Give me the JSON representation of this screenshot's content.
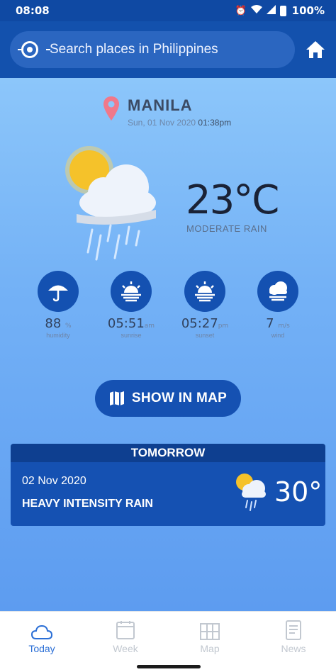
{
  "status_bar": {
    "time": "08:08",
    "battery": "100%"
  },
  "search": {
    "placeholder": "Search places in Philippines"
  },
  "location": {
    "city": "MANILA",
    "date": "Sun, 01 Nov 2020",
    "time": "01:38pm"
  },
  "current": {
    "temperature": "23°C",
    "condition": "MODERATE RAIN",
    "icon": "sun-cloud-rain-icon"
  },
  "stats": [
    {
      "value": "88",
      "unit": "%",
      "label": "humidity",
      "icon": "umbrella-icon"
    },
    {
      "value": "05:51",
      "unit": "am",
      "label": "sunrise",
      "icon": "sunrise-icon"
    },
    {
      "value": "05:27",
      "unit": "pm",
      "label": "sunset",
      "icon": "sunset-icon"
    },
    {
      "value": "7",
      "unit": "m/s",
      "label": "wind",
      "icon": "wind-cloud-icon"
    }
  ],
  "map_button": {
    "label": "SHOW IN MAP"
  },
  "tomorrow": {
    "title": "TOMORROW",
    "date": "02 Nov 2020",
    "condition": "HEAVY INTENSITY RAIN",
    "temperature": "30°"
  },
  "nav": [
    {
      "label": "Today",
      "icon": "cloud-icon",
      "active": true
    },
    {
      "label": "Week",
      "icon": "calendar-icon",
      "active": false
    },
    {
      "label": "Map",
      "icon": "map-icon",
      "active": false
    },
    {
      "label": "News",
      "icon": "news-icon",
      "active": false
    }
  ],
  "colors": {
    "header": "#1351ad",
    "accent": "#1551b2",
    "active_tab": "#2b6fd6"
  }
}
